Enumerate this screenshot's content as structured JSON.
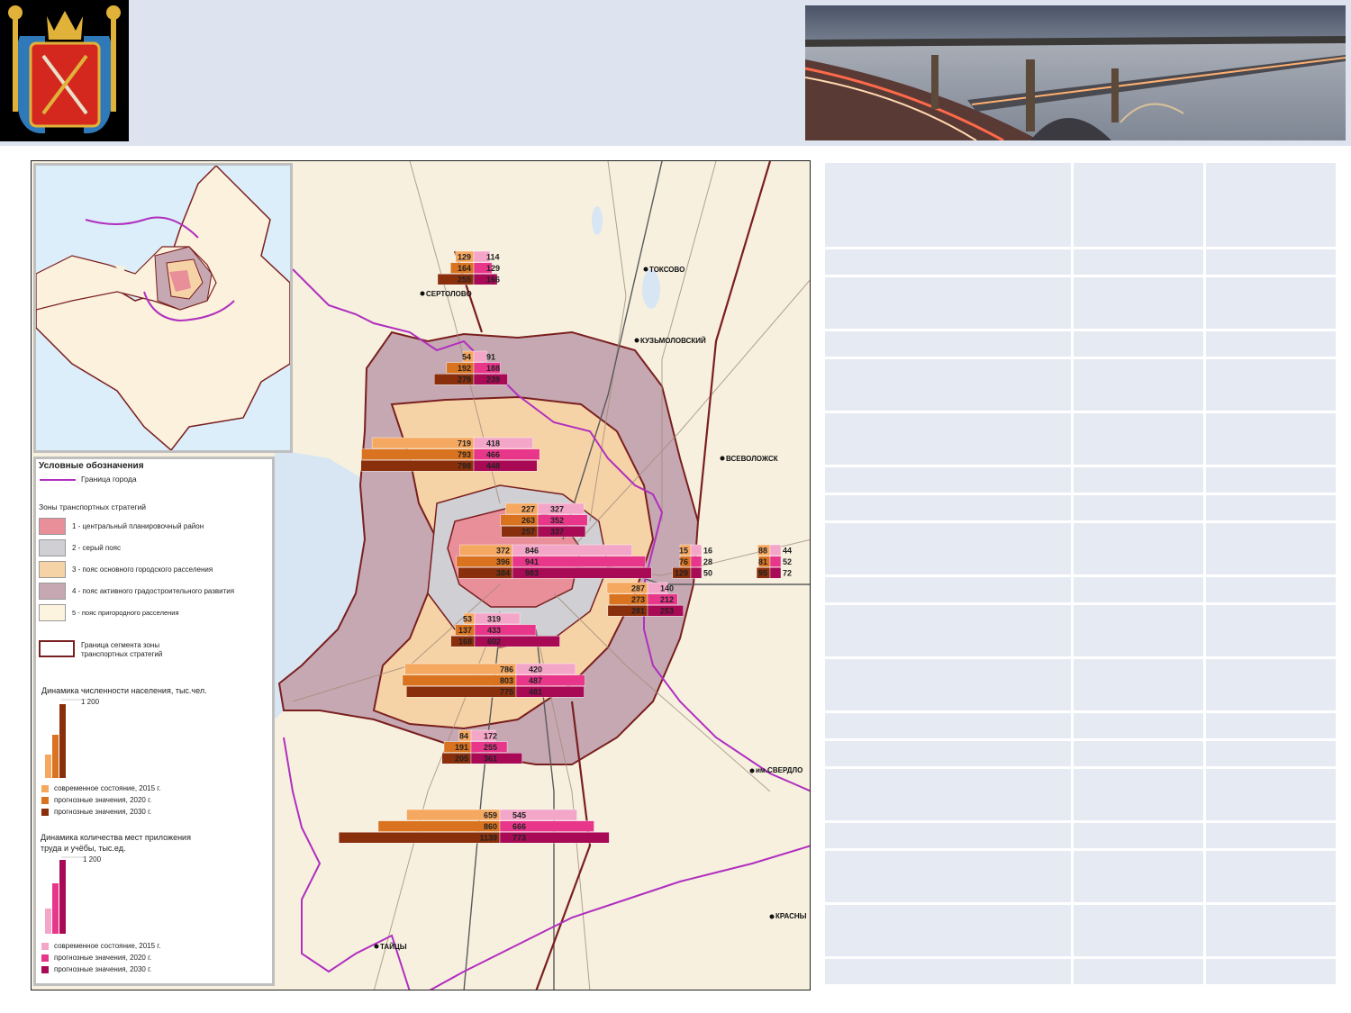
{
  "legend": {
    "title": "Условные обозначения",
    "city_border": "Граница города",
    "zones_title": "Зоны транспортных стратегий",
    "zones": [
      {
        "label": "1 - центральный планировочный район",
        "color": "#e98f9a"
      },
      {
        "label": "2 - серый пояс",
        "color": "#cfcfd4"
      },
      {
        "label": "3 - пояс основного городского расселения",
        "color": "#f6d3a6"
      },
      {
        "label": "4 - пояс активного градостроительного развития",
        "color": "#c6a8b2"
      },
      {
        "label": "5 - пояс пригородного расселения",
        "color": "#fdf4df"
      }
    ],
    "segment_border": "Граница сегмента зоны транспортных стратегий",
    "population_title": "Динамика численности населения, тыс.чел.",
    "population_scale": "1 200",
    "population_items": [
      {
        "label": "современное состояние, 2015 г.",
        "color": "#f5a860"
      },
      {
        "label": "прогнозные значения, 2020 г.",
        "color": "#d9731f"
      },
      {
        "label": "прогнозные значения, 2030 г.",
        "color": "#8a2f0c"
      }
    ],
    "jobs_title": "Динамика количества мест приложения труда и учёбы, тыс.ед.",
    "jobs_scale": "1 200",
    "jobs_items": [
      {
        "label": "современное состояние, 2015 г.",
        "color": "#f4a6c8"
      },
      {
        "label": "прогнозные значения, 2020 г.",
        "color": "#e8368a"
      },
      {
        "label": "прогнозные значения, 2030 г.",
        "color": "#a80a55"
      }
    ]
  },
  "places": [
    "ТОКСОВО",
    "СЕРТОЛОВО",
    "КУЗЬМОЛОВСКИЙ",
    "ВСЕВОЛОЖСК",
    "им.СВЕРДЛО",
    "КРАСНЫ",
    "ТАЙЦЫ"
  ],
  "chart_data": {
    "type": "bar",
    "title": "",
    "groups": [
      {
        "population": [
          129,
          164,
          255
        ],
        "jobs": [
          114,
          129,
          166
        ]
      },
      {
        "population": [
          54,
          192,
          279
        ],
        "jobs": [
          91,
          188,
          239
        ]
      },
      {
        "population": [
          719,
          793,
          798
        ],
        "jobs": [
          418,
          466,
          448
        ]
      },
      {
        "population": [
          227,
          263,
          257
        ],
        "jobs": [
          327,
          352,
          337
        ]
      },
      {
        "population": [
          372,
          396,
          384
        ],
        "jobs": [
          846,
          941,
          983
        ]
      },
      {
        "population": [
          15,
          76,
          129
        ],
        "jobs": [
          16,
          28,
          50
        ]
      },
      {
        "population": [
          88,
          81,
          95
        ],
        "jobs": [
          44,
          52,
          72
        ]
      },
      {
        "population": [
          287,
          273,
          281
        ],
        "jobs": [
          140,
          212,
          253
        ]
      },
      {
        "population": [
          53,
          137,
          168
        ],
        "jobs": [
          319,
          433,
          602
        ]
      },
      {
        "population": [
          786,
          803,
          775
        ],
        "jobs": [
          420,
          487,
          481
        ]
      },
      {
        "population": [
          84,
          191,
          205
        ],
        "jobs": [
          172,
          255,
          361
        ]
      },
      {
        "population": [
          659,
          860,
          1139
        ],
        "jobs": [
          545,
          666,
          773
        ]
      }
    ]
  }
}
